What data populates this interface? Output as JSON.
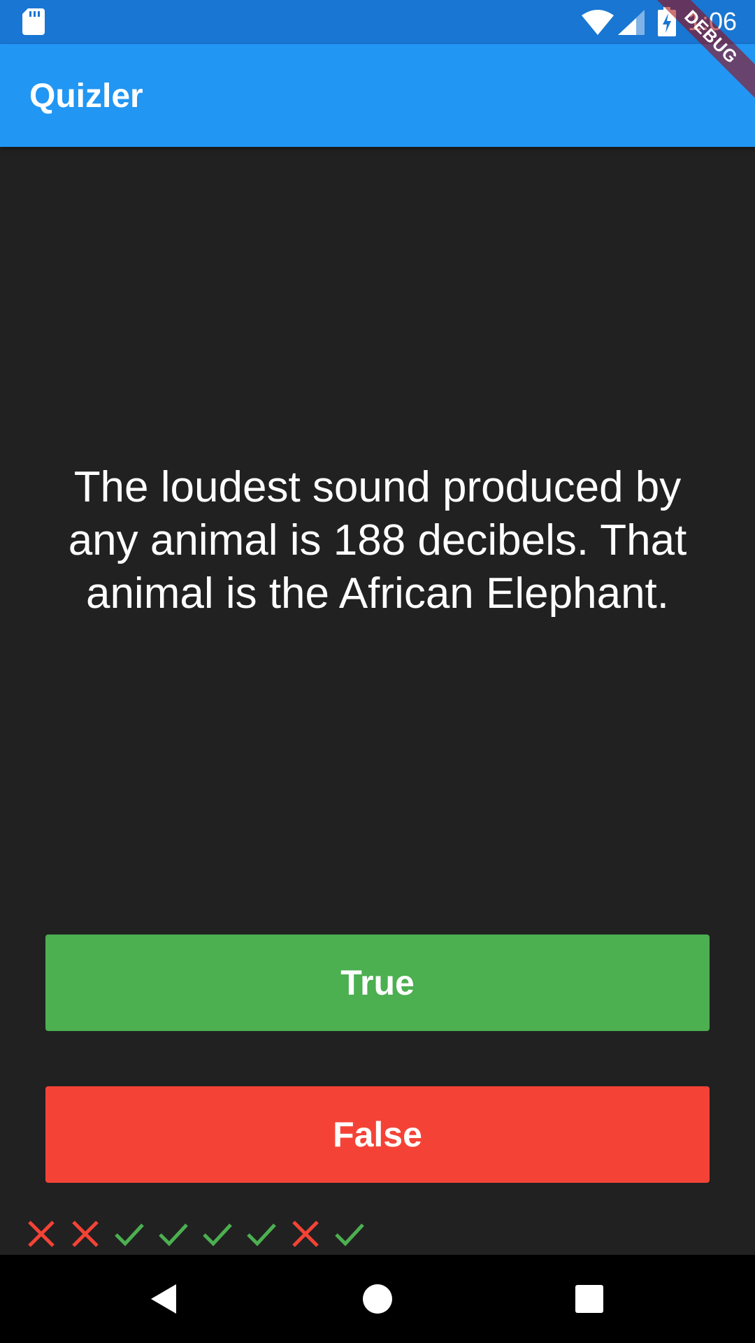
{
  "status_bar": {
    "time": "1:06",
    "icons": [
      "sd-card-icon",
      "wifi-icon",
      "signal-icon",
      "battery-charging-icon"
    ],
    "color": "#1976D2"
  },
  "app_bar": {
    "title": "Quizler",
    "color": "#2196F3"
  },
  "debug_banner": {
    "label": "DEBUG"
  },
  "question": {
    "text": "The loudest sound produced by any animal is 188 decibels. That animal is the African Elephant."
  },
  "buttons": {
    "true_label": "True",
    "false_label": "False",
    "true_color": "#4CAF50",
    "false_color": "#F44336"
  },
  "score_keeper": {
    "marks": [
      "wrong",
      "wrong",
      "correct",
      "correct",
      "correct",
      "correct",
      "wrong",
      "correct"
    ],
    "correct_color": "#4CAF50",
    "wrong_color": "#F44336"
  },
  "nav_bar": {
    "icons": [
      "back-icon",
      "home-icon",
      "recents-icon"
    ]
  }
}
